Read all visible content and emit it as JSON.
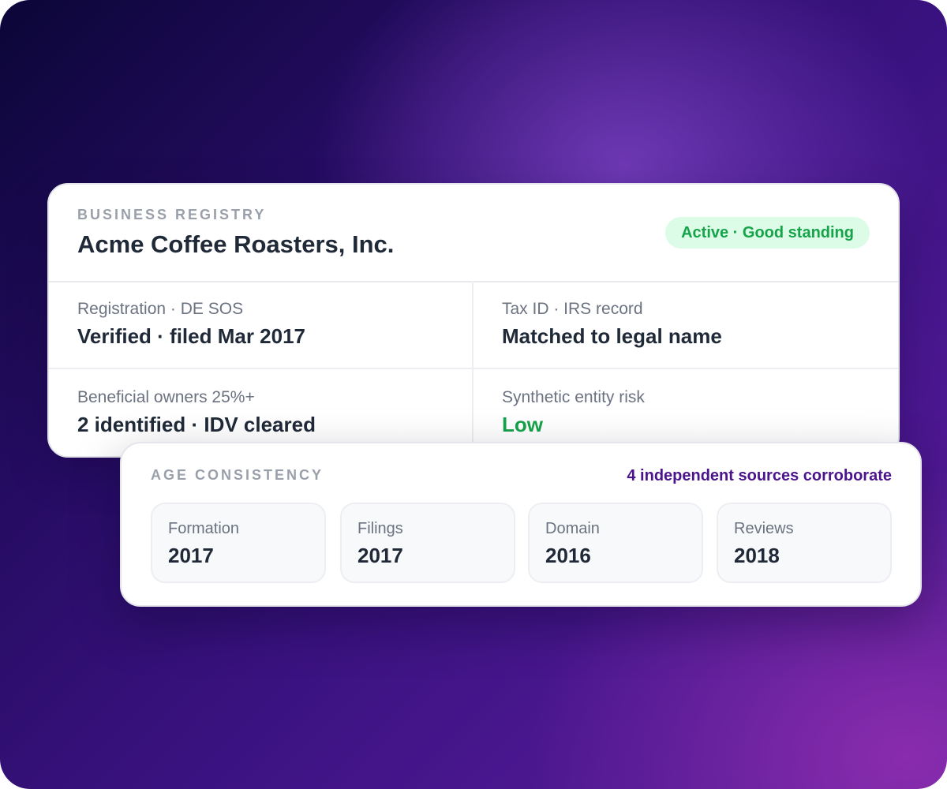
{
  "registry": {
    "eyebrow": "BUSINESS REGISTRY",
    "company_name": "Acme Coffee Roasters, Inc.",
    "status_badge": "Active · Good standing",
    "fields": [
      {
        "label": "Registration · DE SOS",
        "value": "Verified · filed Mar 2017"
      },
      {
        "label": "Tax ID · IRS record",
        "value": "Matched to legal name"
      },
      {
        "label": "Beneficial owners 25%+",
        "value": "2 identified · IDV cleared"
      },
      {
        "label": "Synthetic entity risk",
        "value": "Low"
      }
    ]
  },
  "age_consistency": {
    "eyebrow": "AGE CONSISTENCY",
    "summary": "4 independent sources corroborate",
    "sources": [
      {
        "label": "Formation",
        "year": "2017"
      },
      {
        "label": "Filings",
        "year": "2017"
      },
      {
        "label": "Domain",
        "year": "2016"
      },
      {
        "label": "Reviews",
        "year": "2018"
      }
    ]
  },
  "colors": {
    "status_green": "#16a34a",
    "status_badge_bg": "#dcfce7",
    "accent_purple": "#4a148c",
    "background_dark": "#0b0638",
    "background_light": "#8a2cae"
  }
}
